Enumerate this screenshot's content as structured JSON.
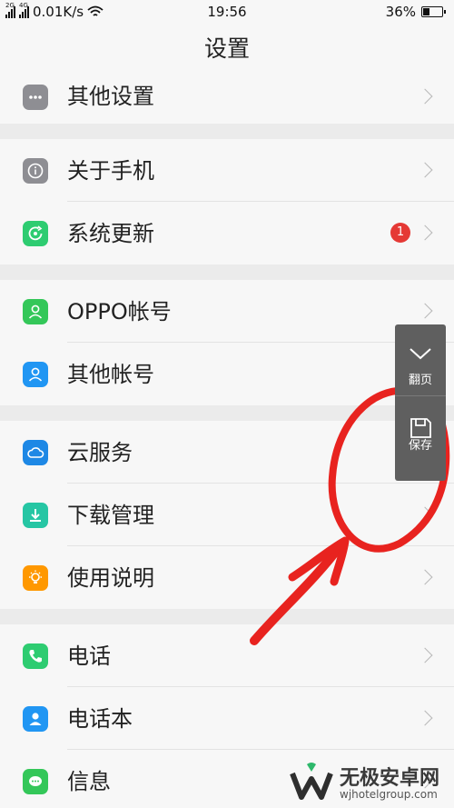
{
  "status_bar": {
    "network_left": "2G",
    "network_right": "4G",
    "speed": "0.01K/s",
    "time": "19:56",
    "battery_text": "36%",
    "battery_level": 0.36
  },
  "header": {
    "title": "设置"
  },
  "groups": [
    [
      {
        "label": "其他设置",
        "icon": "more-dots-icon",
        "color": "#8e8e93"
      }
    ],
    [
      {
        "label": "关于手机",
        "icon": "info-icon",
        "color": "#8e8e93"
      },
      {
        "label": "系统更新",
        "icon": "update-icon",
        "color": "#2ecc71",
        "badge": "1"
      }
    ],
    [
      {
        "label": "OPPO帐号",
        "icon": "user-icon",
        "color": "#34c759"
      },
      {
        "label": "其他帐号",
        "icon": "user-icon",
        "color": "#2196f3"
      }
    ],
    [
      {
        "label": "云服务",
        "icon": "cloud-icon",
        "color": "#1e88e5"
      },
      {
        "label": "下载管理",
        "icon": "download-icon",
        "color": "#26c6a4"
      },
      {
        "label": "使用说明",
        "icon": "bulb-icon",
        "color": "#ff9800"
      }
    ],
    [
      {
        "label": "电话",
        "icon": "phone-icon",
        "color": "#2ecc71"
      },
      {
        "label": "电话本",
        "icon": "contacts-icon",
        "color": "#2196f3"
      },
      {
        "label": "信息",
        "icon": "message-icon",
        "color": "#34c759"
      }
    ]
  ],
  "float_tool": {
    "page_turn_label": "翻页",
    "save_label": "保存"
  },
  "watermark": {
    "title": "无极安卓网",
    "url": "wjhotelgroup.com"
  },
  "colors": {
    "annotation": "#e8231f",
    "badge": "#e53935"
  }
}
